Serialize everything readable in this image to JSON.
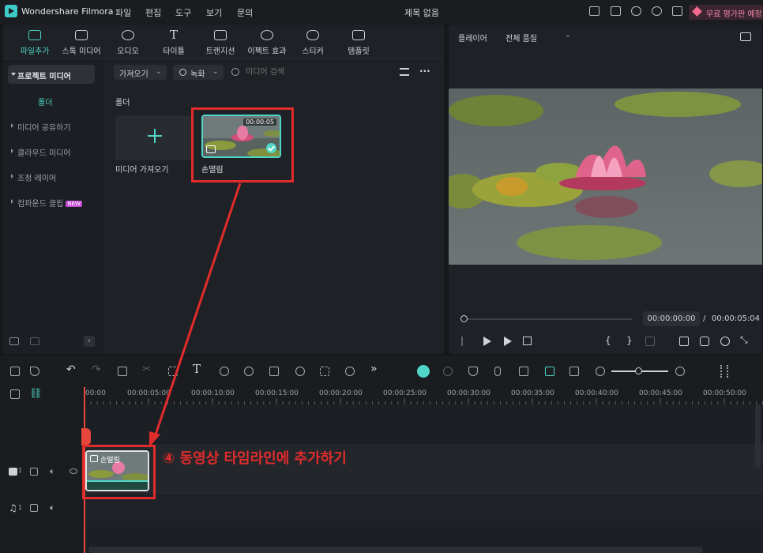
{
  "app": {
    "name": "Wondershare Filmora",
    "menus": [
      "파일",
      "편집",
      "도구",
      "보기",
      "문의"
    ],
    "document_title": "제목 없음",
    "trial_label": "무료 평가판 예정"
  },
  "library": {
    "tabs": [
      "파일추가",
      "스톡 미디어",
      "오디오",
      "타이틀",
      "트랜지션",
      "이펙트 효과",
      "스티커",
      "템플릿"
    ],
    "active_tab": 0,
    "sidebar": {
      "project_media": "프로젝트 미디어",
      "folder": "폴더",
      "items": [
        "미디어 공유하기",
        "클라우드 미디어",
        "조정 레이어",
        "컴파운드 클립"
      ],
      "new_badge": "NEW"
    },
    "toolbar": {
      "import_label": "가져오기",
      "record_label": "녹화",
      "search_placeholder": "미디어 검색"
    },
    "folder_title": "폴더",
    "import_card_label": "미디어 가져오기",
    "clip": {
      "name": "손떨림",
      "duration": "00:00:05"
    }
  },
  "player": {
    "label": "플레이어",
    "quality": "전체 품질",
    "current_time": "00:00:00:00",
    "separator": "/",
    "total_time": "00:00:05:04"
  },
  "timeline": {
    "ruler": [
      "00:00",
      "00:00:05:00",
      "00:00:10:00",
      "00:00:15:00",
      "00:00:20:00",
      "00:00:25:00",
      "00:00:30:00",
      "00:00:35:00",
      "00:00:40:00",
      "00:00:45:00",
      "00:00:50:00"
    ],
    "video_track_num": "1",
    "audio_track_num": "1",
    "clip_name": "손떨림"
  },
  "annotation": {
    "text": "④ 동영상 타임라인에 추가하기",
    "color": "#e12c2c"
  },
  "colors": {
    "accent": "#4fd6c8",
    "playhead": "#e8453c",
    "background": "#16181c"
  }
}
